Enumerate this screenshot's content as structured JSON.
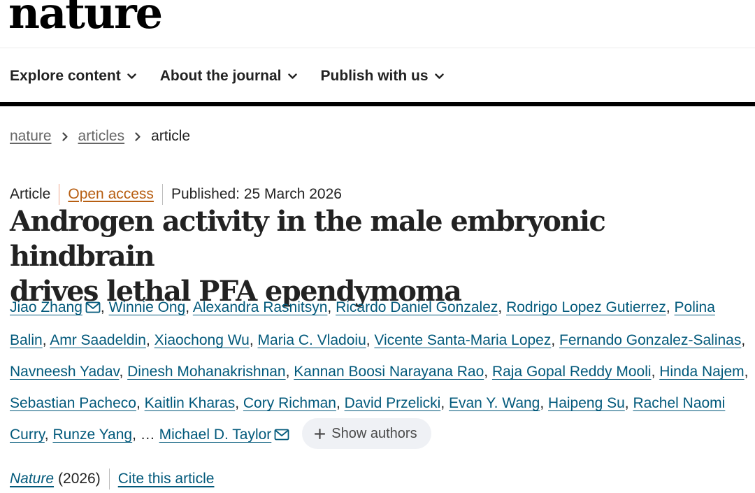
{
  "logo": {
    "text": "nature"
  },
  "nav": {
    "items": [
      {
        "label": "Explore content",
        "icon": "chevron-down-icon"
      },
      {
        "label": "About the journal",
        "icon": "chevron-down-icon"
      },
      {
        "label": "Publish with us",
        "icon": "chevron-down-icon"
      }
    ]
  },
  "breadcrumb": {
    "items": [
      "nature",
      "articles"
    ],
    "current": "article",
    "separator_icon": "chevron-right-icon"
  },
  "meta": {
    "type": "Article",
    "access": "Open access",
    "published": "Published: 25 March 2026"
  },
  "title": {
    "line1": "Androgen activity in the male embryonic hindbrain",
    "line2": "drives lethal PFA ependymoma"
  },
  "authors": {
    "list": [
      "Jiao Zhang",
      "Winnie Ong",
      "Alexandra Rasnitsyn",
      "Ricardo Daniel Gonzalez",
      "Rodrigo Lopez Gutierrez",
      "Polina Balin",
      "Amr Saadeldin",
      "Xiaochong Wu",
      "Maria C. Vladoiu",
      "Vicente Santa-Maria Lopez",
      "Fernando Gonzalez-Salinas",
      "Navneesh Yadav",
      "Dinesh Mohanakrishnan",
      "Kannan Boosi Narayana Rao",
      "Raja Gopal Reddy Mooli",
      "Hinda Najem",
      "Sebastian Pacheco",
      "Kaitlin Kharas",
      "Cory Richman",
      "David Przelicki",
      "Evan Y. Wang",
      "Haipeng Su",
      "Rachel Naomi Curry",
      "Runze Yang"
    ],
    "ellipsis": "…",
    "last": "Michael D. Taylor",
    "show_authors_label": "Show authors",
    "corresponding_icon": "mail-icon"
  },
  "citation": {
    "journal": "Nature",
    "year": "(2026)",
    "cite_label": "Cite this article"
  },
  "colors": {
    "link": "#02597b",
    "open_access": "#b75e12",
    "text": "#222222",
    "muted": "#666666",
    "pill_bg": "#eff1f5"
  }
}
